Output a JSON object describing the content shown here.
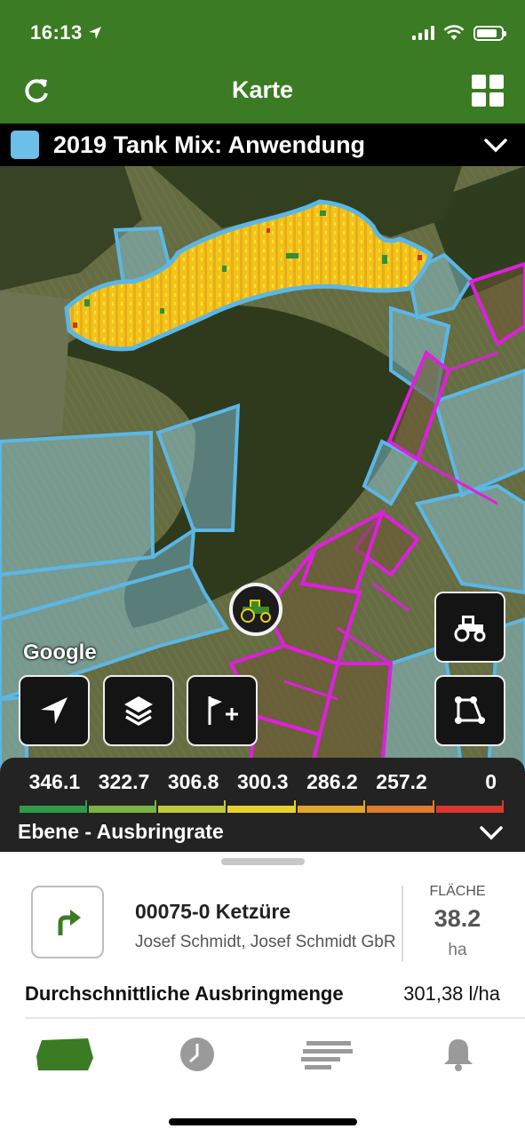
{
  "status_bar": {
    "time": "16:13",
    "battery_level": 0.85
  },
  "header": {
    "title": "Karte"
  },
  "layer_selector": {
    "name": "2019 Tank Mix: Anwendung",
    "swatch_color": "#6bbfe8"
  },
  "map": {
    "attribution": "Google"
  },
  "legend": {
    "title": "Ebene - Ausbringrate",
    "items": [
      {
        "value": "346.1",
        "color": "#2e9a4a"
      },
      {
        "value": "322.7",
        "color": "#7bb342"
      },
      {
        "value": "306.8",
        "color": "#c0c93a"
      },
      {
        "value": "300.3",
        "color": "#e6d32a"
      },
      {
        "value": "286.2",
        "color": "#e3a62a"
      },
      {
        "value": "257.2",
        "color": "#e07a2c"
      },
      {
        "value": "0",
        "color": "#d9372f"
      }
    ]
  },
  "field": {
    "name": "00075-0 Ketzüre",
    "owner": "Josef Schmidt, Josef Schmidt GbR",
    "area_label": "FLÄCHE",
    "area_value": "38.2",
    "area_unit": "ha"
  },
  "summary": {
    "label": "Durchschnittliche Ausbringmenge",
    "value": "301,38 l/ha"
  },
  "colors": {
    "brand_green": "#3a7b23",
    "tab_inactive": "#9a9a9a",
    "boundary_blue": "#5ab7e6",
    "boundary_magenta": "#e01ee0"
  }
}
